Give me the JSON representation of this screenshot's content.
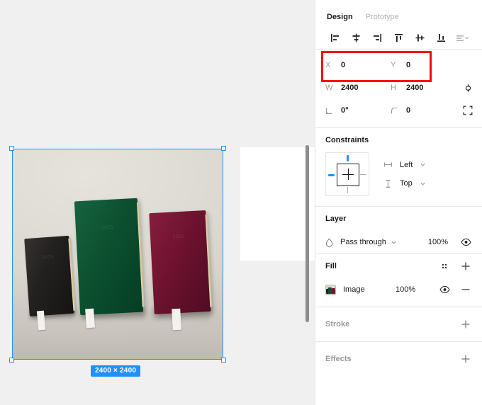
{
  "canvas": {
    "selection": {
      "size_badge": "2400 × 2400",
      "selection_color": "#1e90ff"
    },
    "image": {
      "name": "notebooks-photo",
      "books": [
        {
          "name": "black-notebook",
          "emboss": "2025"
        },
        {
          "name": "green-notebook",
          "emboss": "2025"
        },
        {
          "name": "burgundy-notebook",
          "emboss": "2025"
        }
      ]
    }
  },
  "panel": {
    "tabs": [
      {
        "label": "Design",
        "active": true
      },
      {
        "label": "Prototype",
        "active": false
      }
    ],
    "align_tools": [
      {
        "name": "align-left-icon",
        "label": "Align left",
        "disabled": false
      },
      {
        "name": "align-horizontal-centers-icon",
        "label": "Align horizontal centers",
        "disabled": false
      },
      {
        "name": "align-right-icon",
        "label": "Align right",
        "disabled": false
      },
      {
        "name": "align-top-icon",
        "label": "Align top",
        "disabled": false
      },
      {
        "name": "align-vertical-centers-icon",
        "label": "Align vertical centers",
        "disabled": false
      },
      {
        "name": "align-bottom-icon",
        "label": "Align bottom",
        "disabled": false
      },
      {
        "name": "distribute-menu-icon",
        "label": "Distribute",
        "disabled": true
      }
    ],
    "transform": {
      "highlight_color": "#ff0000",
      "x": {
        "label": "X",
        "value": "0"
      },
      "y": {
        "label": "Y",
        "value": "0"
      },
      "w": {
        "label": "W",
        "value": "2400"
      },
      "h": {
        "label": "H",
        "value": "2400"
      },
      "rotation": {
        "label": "rotation",
        "value": "0°"
      },
      "corner_radius": {
        "label": "corner-radius",
        "value": "0"
      },
      "proportion_lock": "proportions-lock-icon",
      "independent_corners": "independent-corners-icon"
    },
    "constraints": {
      "title": "Constraints",
      "horizontal": {
        "value": "Left",
        "active_side": "left"
      },
      "vertical": {
        "value": "Top",
        "active_side": "top"
      }
    },
    "layer": {
      "title": "Layer",
      "blend_mode": "Pass through",
      "opacity": "100%",
      "visible_icon": "eye-icon"
    },
    "fill": {
      "title": "Fill",
      "item_name": "Image",
      "opacity": "100%",
      "visible_icon": "eye-icon",
      "remove_icon": "minus-icon",
      "settings_icon": "fill-settings-icon",
      "add_icon": "plus-icon"
    },
    "stroke": {
      "title": "Stroke",
      "add_icon": "plus-icon"
    },
    "effects": {
      "title": "Effects",
      "add_icon": "plus-icon"
    }
  }
}
